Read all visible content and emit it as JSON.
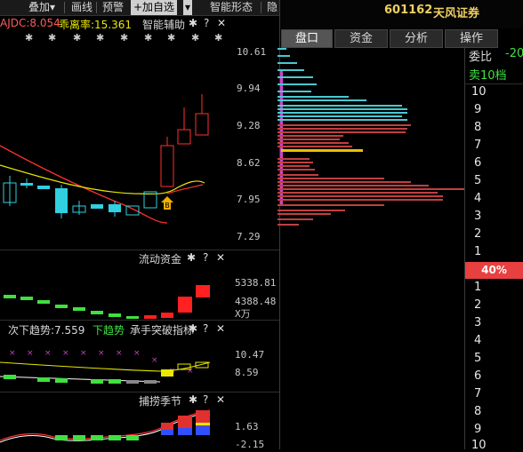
{
  "toolbar": {
    "items": [
      "叠加▾",
      "画线",
      "预警",
      "+加自选",
      "▾",
      "智能形态",
      "隐"
    ]
  },
  "indicator_line": {
    "a": "AJDC:8.054",
    "b": "乖离率:15.361",
    "c": "智能辅助"
  },
  "main_axis": [
    "10.61",
    "9.94",
    "9.28",
    "8.62",
    "7.95",
    "7.29"
  ],
  "flow_panel": {
    "title": "流动资金",
    "axis": [
      "5338.81",
      "4388.48",
      "X万"
    ]
  },
  "trend_panel": {
    "label_a": "次下趋势:7.559",
    "label_b": "下趋势",
    "label_c": "承手突破指标",
    "axis": [
      "10.47",
      "8.59"
    ]
  },
  "season_panel": {
    "title": "捕捞季节",
    "axis": [
      "1.63",
      "-2.15"
    ]
  },
  "right": {
    "stock_code": "601162",
    "stock_name": "天风证券",
    "tabs": [
      "盘口",
      "资金",
      "分析",
      "操作"
    ],
    "weibi_label": "委比",
    "weibi_value": "-20",
    "sell_label": "卖10档",
    "sell_levels": [
      "10",
      "9",
      "8",
      "7",
      "6",
      "5",
      "4",
      "3",
      "2",
      "1"
    ],
    "ratio": "40%",
    "buy_levels": [
      "1",
      "2",
      "3",
      "4",
      "5",
      "6",
      "7",
      "8",
      "9",
      "10"
    ]
  },
  "colors": {
    "bg": "#000000",
    "up": "#ff3030",
    "down": "#30d0e0",
    "yellow": "#e8e800",
    "green": "#40e040",
    "cyan_bars": "#4ac8d0",
    "red_bars": "#c04040"
  }
}
